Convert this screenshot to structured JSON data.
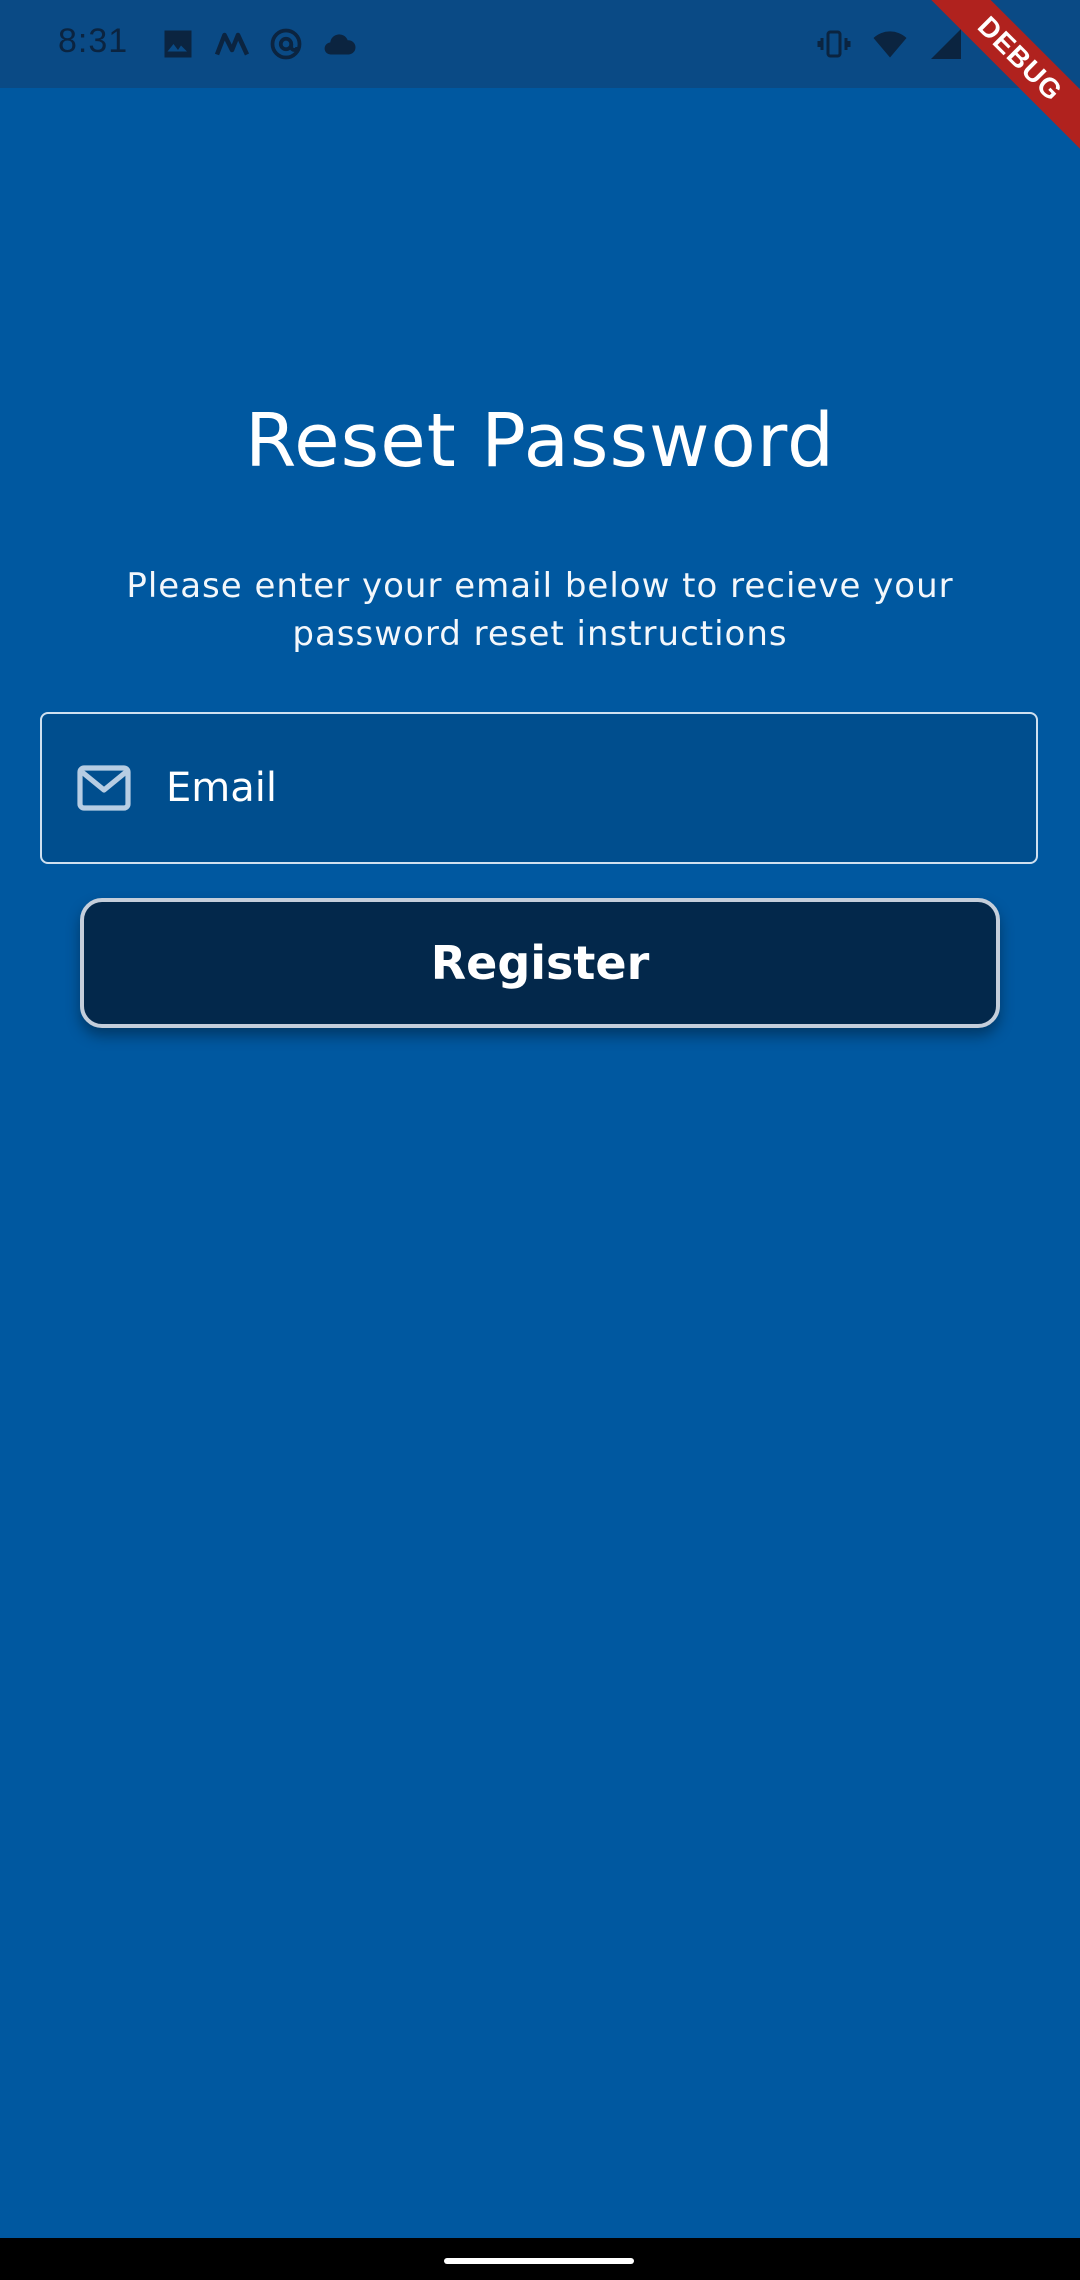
{
  "status_bar": {
    "time": "8:31",
    "left_icons": [
      "image-icon",
      "m-app-icon",
      "at-sign-icon",
      "cloud-icon"
    ],
    "right_icons": [
      "vibrate-icon",
      "wifi-icon",
      "signal-icon",
      "battery-icon"
    ]
  },
  "debug_banner": {
    "label": "DEBUG",
    "color": "#b0221e"
  },
  "screen": {
    "title": "Reset Password",
    "instructions": "Please enter your email below to recieve your password reset instructions",
    "email_field": {
      "placeholder": "Email",
      "value": "",
      "icon": "mail-icon"
    },
    "submit_button": {
      "label": "Register"
    }
  },
  "colors": {
    "background": "#0058a0",
    "status_bar": "#0a4a85",
    "button": "#03284b",
    "field_background": "#004e8e"
  }
}
